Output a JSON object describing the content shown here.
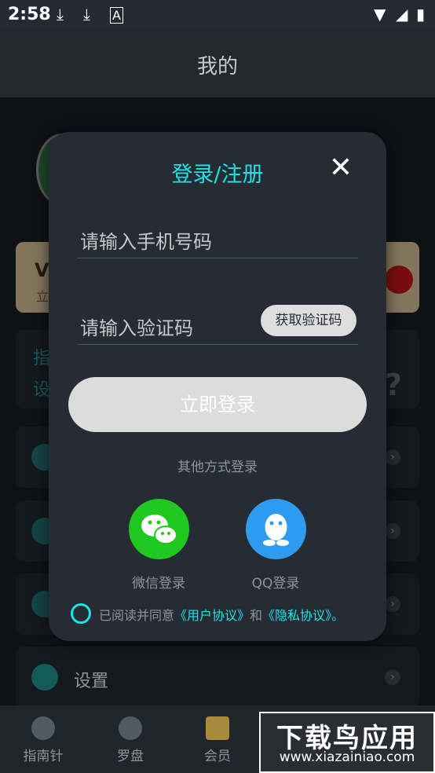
{
  "status_bar": {
    "time": "2:58"
  },
  "header": {
    "title": "我的"
  },
  "background": {
    "vip_title": "V",
    "vip_sub": "立",
    "guide_line1": "指",
    "guide_line2": "设",
    "question_mark": "?",
    "settings_label": "设置"
  },
  "bottom_nav": [
    {
      "label": "指南针"
    },
    {
      "label": "罗盘"
    },
    {
      "label": "会员"
    }
  ],
  "watermark": {
    "big": "下载鸟应用",
    "small": "www.xiazainiao.com"
  },
  "dialog": {
    "title": "登录/注册",
    "phone_placeholder": "请输入手机号码",
    "code_placeholder": "请输入验证码",
    "get_code_label": "获取验证码",
    "login_label": "立即登录",
    "other_methods_label": "其他方式登录",
    "wechat_label": "微信登录",
    "qq_label": "QQ登录",
    "agreement_prefix": "已阅读并同意",
    "user_agreement": "《用户协议》",
    "and_text": "和",
    "privacy_agreement": "《隐私协议》",
    "agreement_suffix": "。"
  },
  "colors": {
    "accent": "#1ee2e6",
    "wechat": "#1fc91f",
    "qq": "#2f9bf0",
    "dialog_bg": "#262c34"
  }
}
